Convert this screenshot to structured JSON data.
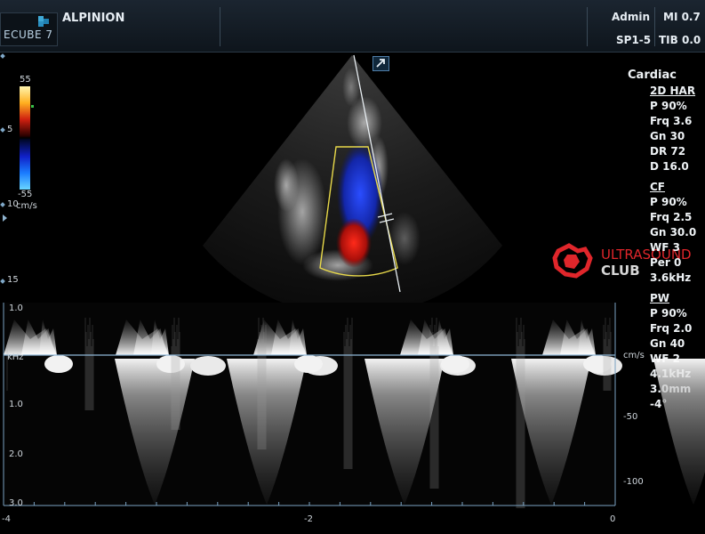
{
  "header": {
    "logo_text": "ECUBE 7",
    "brand": "ALPINION",
    "user": "Admin",
    "mi": "MI 0.7",
    "probe": "SP1-5",
    "tib": "TIB 0.0"
  },
  "preset": "Cardiac",
  "mode_2d": {
    "title": "2D HAR",
    "lines": [
      "P 90%",
      "Frq 3.6",
      "Gn 30",
      "DR 72",
      "D 16.0"
    ]
  },
  "mode_cf": {
    "title": "CF",
    "lines": [
      "P 90%",
      "Frq 2.5",
      "Gn 30.0",
      "WF 3",
      "Per 0",
      "3.6kHz"
    ]
  },
  "mode_pw": {
    "title": "PW",
    "lines": [
      "P 90%",
      "Frq 2.0",
      "Gn 40",
      "WF 2",
      "4.1kHz",
      "3.0mm",
      "-4°"
    ]
  },
  "color_bar": {
    "max": "55",
    "min": "-55",
    "unit": "cm/s",
    "colors": {
      "positive": "#ffe07a",
      "negative": "#2aa8ff"
    }
  },
  "depth_scale": [
    "5",
    "10",
    "15"
  ],
  "watermark": {
    "line1": "ULTRASOUND",
    "line2": "CLUB",
    "color": "#e0262b"
  },
  "doppler": {
    "left_ticks": [
      "1.0",
      "kHz",
      "1.0",
      "2.0",
      "3.0"
    ],
    "right_unit": "cm/s",
    "right_ticks": [
      "-50",
      "-100"
    ],
    "time_ticks": [
      "-4",
      "-2",
      "0"
    ]
  },
  "icons": {
    "mode_toggle": "arrow-up-right-icon",
    "logo_mark": "cube-logo-icon"
  }
}
